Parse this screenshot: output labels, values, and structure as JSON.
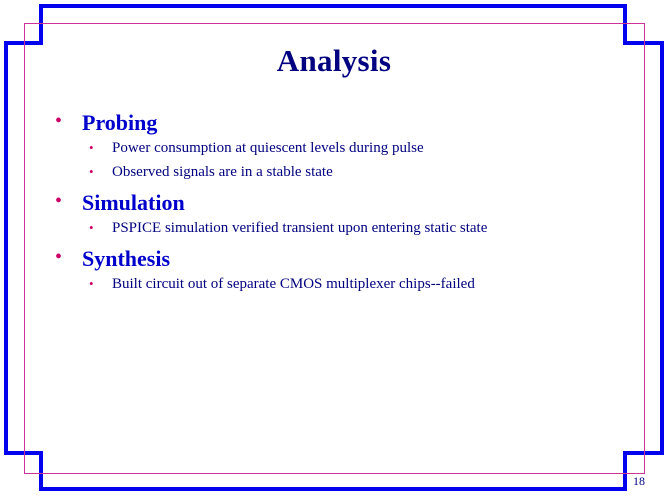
{
  "slide": {
    "title": "Analysis",
    "page_number": "18"
  },
  "bullets": [
    {
      "label": "Probing",
      "sub": [
        "Power consumption at quiescent levels during pulse",
        "Observed signals are in a stable state"
      ]
    },
    {
      "label": "Simulation",
      "sub": [
        "PSPICE simulation verified transient upon entering static state"
      ]
    },
    {
      "label": "Synthesis",
      "sub": [
        "Built circuit out of separate CMOS multiplexer chips--failed"
      ]
    }
  ],
  "colors": {
    "frame": "#0000ee",
    "inner_rule": "#cc3399",
    "title": "#000080",
    "heading": "#0000cc",
    "bullet": "#cc0066"
  }
}
